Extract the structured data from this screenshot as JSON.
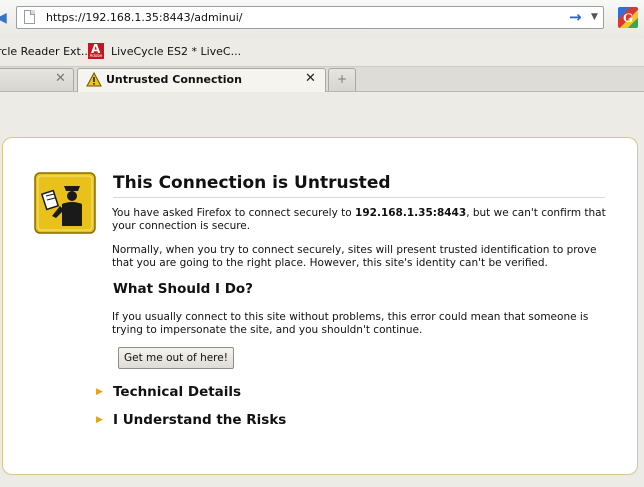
{
  "browser": {
    "url": "https://192.168.1.35:8443/adminui/",
    "bookmarks": [
      {
        "label": "rcle Reader Ext..."
      },
      {
        "label": "LiveCycle ES2 * LiveC..."
      }
    ],
    "tabs": [
      {
        "label": ""
      },
      {
        "label": "Untrusted Connection",
        "active": true
      }
    ],
    "new_tab_symbol": "+",
    "close_symbol": "✕",
    "search_engine_letter": "G"
  },
  "error_page": {
    "title": "This Connection is Untrusted",
    "p1_prefix": "You have asked Firefox to connect securely to ",
    "p1_host": "192.168.1.35:8443",
    "p1_suffix": ", but we can't confirm that your connection is secure.",
    "p2": "Normally, when you try to connect securely, sites will present trusted identification to prove that you are going to the right place. However, this site's identity can't be verified.",
    "what_heading": "What Should I Do?",
    "p3": "If you usually connect to this site without problems, this error could mean that someone is trying to impersonate the site, and you shouldn't continue.",
    "get_out_button": "Get me out of here!",
    "technical_details": "Technical Details",
    "understand_risks": "I Understand the Risks"
  },
  "colors": {
    "accent_yellow": "#e8c21a",
    "expander_triangle": "#e4a11b",
    "box_border": "#d9c58a"
  },
  "icons": [
    "back-arrow-icon",
    "page-icon",
    "go-arrow-icon",
    "dropdown-icon",
    "search-engine-icon",
    "adobe-icon",
    "warning-icon",
    "close-icon",
    "security-officer-icon",
    "triangle-right-icon"
  ]
}
